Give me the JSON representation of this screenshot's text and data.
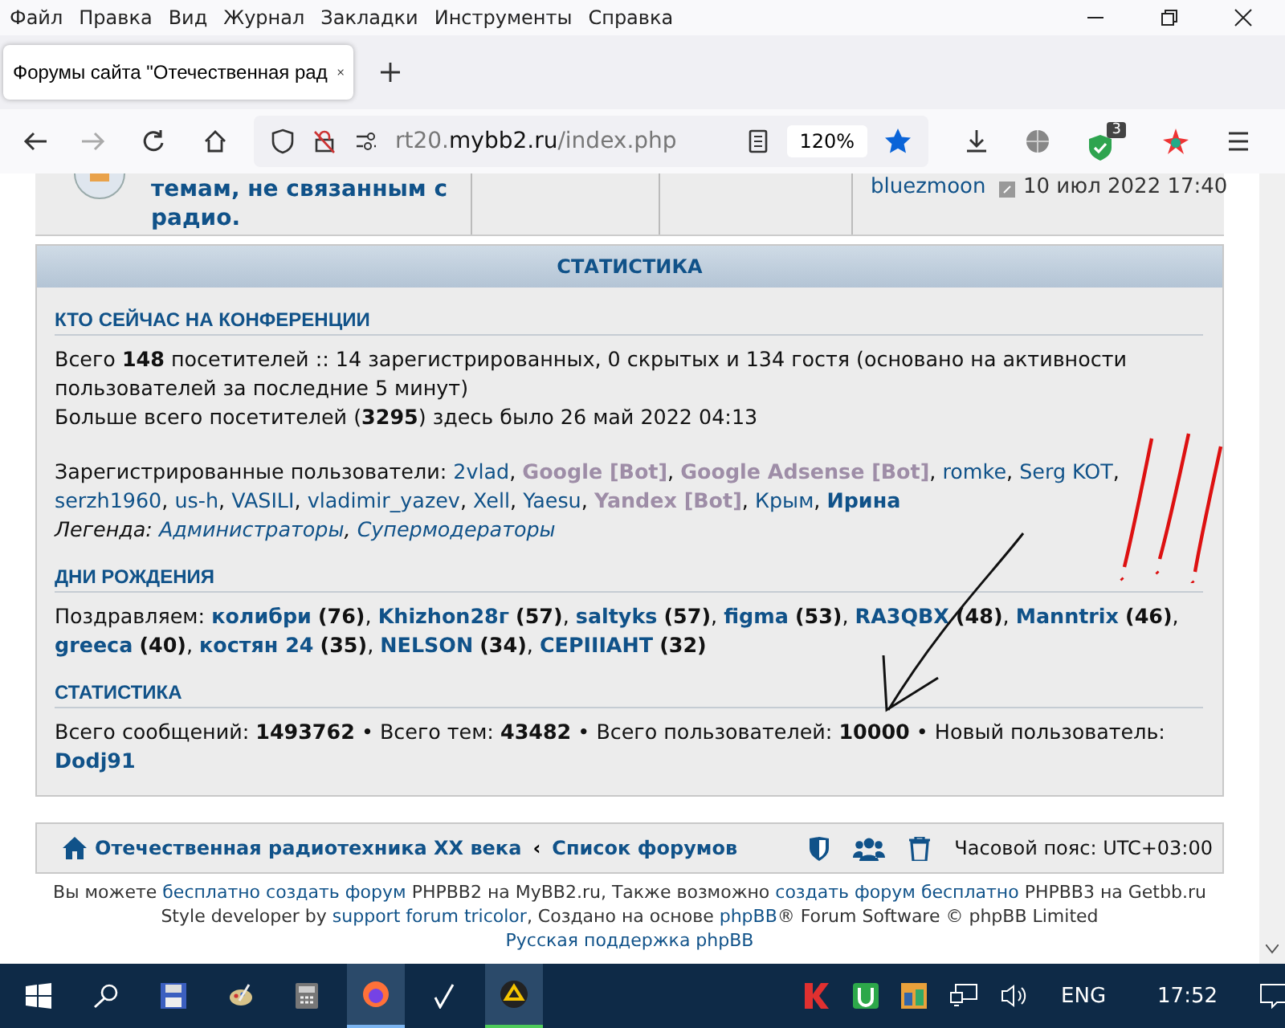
{
  "browser": {
    "menu": [
      "Файл",
      "Правка",
      "Вид",
      "Журнал",
      "Закладки",
      "Инструменты",
      "Справка"
    ],
    "tab_title": "Форумы сайта \"Отечественная рад",
    "url": {
      "host_prefix": "rt20.",
      "host_main": "mybb2.ru",
      "path": "/index.php"
    },
    "zoom": "120%",
    "shield_badge": "3"
  },
  "forum_row": {
    "title": "темам, не связанным с радио.",
    "last_post_user": "bluezmoon",
    "last_post_date": "10 июл 2022 17:40"
  },
  "stats": {
    "header": "СТАТИСТИКА",
    "online": {
      "title": "КТО СЕЙЧАС НА КОНФЕРЕНЦИИ",
      "lines": [
        "Всего **148** посетителей :: 14 зарегистрированных, 0 скрытых и 134 гостя (основано на активности пользователей за последние 5 минут)",
        "Больше всего посетителей (**3295**) здесь было 26 май 2022 04:13"
      ],
      "registered_label": "Зарегистрированные пользователи:",
      "separator": ",",
      "users": [
        {
          "name": "2vlad",
          "kind": "user"
        },
        {
          "name": "Google [Bot]",
          "kind": "bot"
        },
        {
          "name": "Google Adsense [Bot]",
          "kind": "bot"
        },
        {
          "name": "romke",
          "kind": "user"
        },
        {
          "name": "Serg KOT",
          "kind": "user"
        },
        {
          "name": "serzh1960",
          "kind": "user"
        },
        {
          "name": "us-h",
          "kind": "user"
        },
        {
          "name": "VASILI",
          "kind": "user"
        },
        {
          "name": "vladimir_yazev",
          "kind": "user"
        },
        {
          "name": "Xell",
          "kind": "user"
        },
        {
          "name": "Yaesu",
          "kind": "user"
        },
        {
          "name": "Yandex [Bot]",
          "kind": "bot"
        },
        {
          "name": "Крым",
          "kind": "user"
        },
        {
          "name": "Ирина",
          "kind": "moderator"
        }
      ],
      "legend_label": "Легенда:",
      "legend": [
        "Администраторы",
        "Супермодераторы"
      ]
    },
    "birthdays": {
      "title": "ДНИ РОЖДЕНИЯ",
      "label": "Поздравляем:",
      "separator": ",",
      "people": [
        {
          "name": "колибри",
          "age": "(76)"
        },
        {
          "name": "Khizhon28г",
          "age": "(57)"
        },
        {
          "name": "saltyks",
          "age": "(57)"
        },
        {
          "name": "figma",
          "age": "(53)"
        },
        {
          "name": "RA3QBX",
          "age": "(48)"
        },
        {
          "name": "Manntrix",
          "age": "(46)"
        },
        {
          "name": "greeca",
          "age": "(40)"
        },
        {
          "name": "костян 24",
          "age": "(35)"
        },
        {
          "name": "NELSON",
          "age": "(34)"
        },
        {
          "name": "СЕРIIIАНТ",
          "age": "(32)"
        }
      ]
    },
    "statistics": {
      "title": "СТАТИСТИКА",
      "text": "Всего сообщений: **1493762** • Всего тем: **43482** • Всего пользователей: **10000** • Новый пользователь:",
      "newest_user": "Dodj91"
    }
  },
  "footer_bar": {
    "home": "Отечественная радиотехника XX века",
    "separator": "‹",
    "forums": "Список форумов",
    "timezone": "Часовой пояс: UTC+03:00"
  },
  "credits": [
    [
      {
        "text": "Вы можете ",
        "link": false
      },
      {
        "text": "бесплатно создать форум",
        "link": true
      },
      {
        "text": " PHPBB2 на MyBB2.ru, Также возможно ",
        "link": false
      },
      {
        "text": "создать форум бесплатно",
        "link": true
      },
      {
        "text": " PHPBB3 на Getbb.ru",
        "link": false
      }
    ],
    [
      {
        "text": "Style developer by ",
        "link": false
      },
      {
        "text": "support forum tricolor",
        "link": true
      },
      {
        "text": ", Создано на основе ",
        "link": false
      },
      {
        "text": "phpBB",
        "link": true
      },
      {
        "text": "® Forum Software © phpBB Limited",
        "link": false
      }
    ],
    [
      {
        "text": "Русская поддержка phpBB",
        "link": true
      }
    ]
  ],
  "taskbar": {
    "language": "ENG",
    "time": "17:52"
  }
}
